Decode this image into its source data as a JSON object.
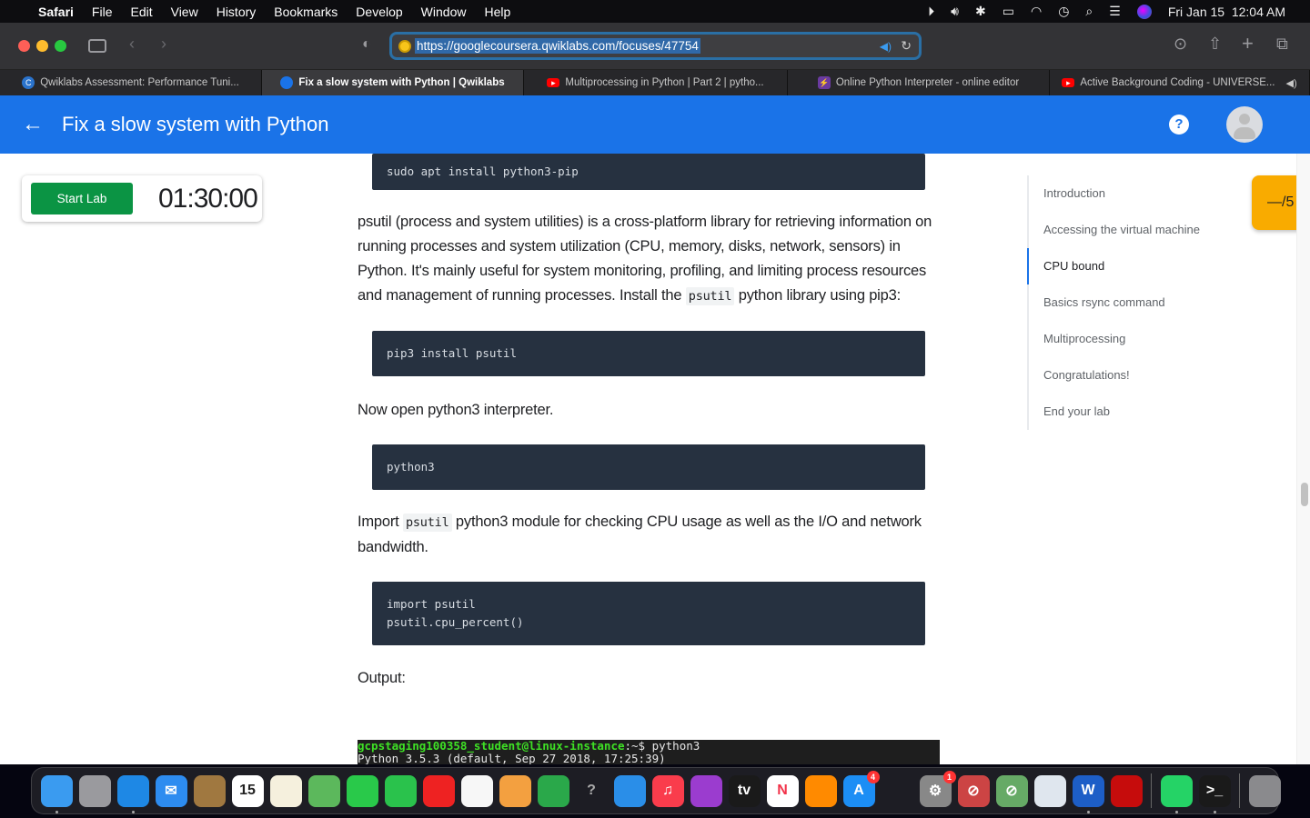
{
  "menubar": {
    "apple_icon": "apple-icon",
    "app_name": "Safari",
    "items": [
      "File",
      "Edit",
      "View",
      "History",
      "Bookmarks",
      "Develop",
      "Window",
      "Help"
    ],
    "status_icons": [
      "play-circle-icon",
      "volume-icon",
      "bluetooth-icon",
      "battery-charging-icon",
      "wifi-icon",
      "time-machine-icon",
      "search-icon",
      "control-center-icon",
      "siri-icon"
    ],
    "datetime": "Fri Jan 15  12:04 AM"
  },
  "toolbar": {
    "url": "https://googlecoursera.qwiklabs.com/focuses/47754"
  },
  "tabs": [
    {
      "title": "Qwiklabs Assessment: Performance Tuni...",
      "icon": "coursera-icon",
      "icon_color": "#2a73cc",
      "active": false
    },
    {
      "title": "Fix a slow system with Python | Qwiklabs",
      "icon": "qwiklabs-icon",
      "icon_color": "#1a73e8",
      "active": true
    },
    {
      "title": "Multiprocessing in Python | Part 2 | pytho...",
      "icon": "youtube-icon",
      "icon_color": "#ff0000",
      "active": false
    },
    {
      "title": "Online Python Interpreter - online editor",
      "icon": "bolt-icon",
      "icon_color": "#6a3aa0",
      "active": false
    },
    {
      "title": "Active Background Coding - UNIVERSE...",
      "icon": "youtube-icon",
      "icon_color": "#ff0000",
      "active": false
    }
  ],
  "appbar": {
    "title": "Fix a slow system with Python",
    "help_label": "?"
  },
  "lab": {
    "start_label": "Start Lab",
    "timer": "01:30:00"
  },
  "content": {
    "code1": "sudo apt install python3-pip",
    "para1": "psutil (process and system utilities) is a cross-platform library for retrieving information on running processes and system utilization (CPU, memory, disks, network, sensors) in Python. It's mainly useful for system monitoring, profiling, and limiting process resources and management of running processes. Install the",
    "para1_code": "psutil",
    "para1_tail": " python library using pip3:",
    "code2": "pip3 install psutil",
    "para2": "Now open python3 interpreter.",
    "code3": "python3",
    "para3_head": "Import ",
    "para3_code": "psutil",
    "para3_tail": " python3 module for checking CPU usage as well as the I/O and network bandwidth.",
    "code4": "import psutil\npsutil.cpu_percent()",
    "para4": "Output:",
    "terminal_prompt_user": "gcpstaging100358_student@linux-instance",
    "terminal_prompt_rest": ":~$ python3",
    "terminal_line2": "Python 3.5.3 (default, Sep 27 2018, 17:25:39)"
  },
  "toc": {
    "items": [
      "Introduction",
      "Accessing the virtual machine",
      "CPU bound",
      "Basics rsync command",
      "Multiprocessing",
      "Congratulations!",
      "End your lab"
    ],
    "active_index": 2
  },
  "score": {
    "label": "—/5"
  },
  "dock": {
    "apps": [
      {
        "name": "finder",
        "label": "",
        "color": "#3a9bf0",
        "running": true
      },
      {
        "name": "launchpad",
        "label": "",
        "color": "#9a9a9e"
      },
      {
        "name": "safari",
        "label": "",
        "color": "#1e88e5",
        "running": true
      },
      {
        "name": "mail",
        "label": "✉",
        "color": "#2d8cf0"
      },
      {
        "name": "contacts",
        "label": "",
        "color": "#a07840"
      },
      {
        "name": "calendar",
        "label": "15",
        "color": "#ffffff",
        "text": "#222"
      },
      {
        "name": "notes",
        "label": "",
        "color": "#f5f0dd"
      },
      {
        "name": "maps",
        "label": "",
        "color": "#5cb85c"
      },
      {
        "name": "messages",
        "label": "",
        "color": "#29c94a"
      },
      {
        "name": "facetime",
        "label": "",
        "color": "#2ac24c"
      },
      {
        "name": "photo-booth",
        "label": "",
        "color": "#e22"
      },
      {
        "name": "photos",
        "label": "",
        "color": "#f7f7f7"
      },
      {
        "name": "pages",
        "label": "",
        "color": "#f3a040"
      },
      {
        "name": "numbers",
        "label": "",
        "color": "#2aa84a"
      },
      {
        "name": "unknown-app",
        "label": "?",
        "color": "transparent",
        "text": "#aaa"
      },
      {
        "name": "keynote",
        "label": "",
        "color": "#2a8ee8"
      },
      {
        "name": "music",
        "label": "♫",
        "color": "#fa3c4c"
      },
      {
        "name": "podcasts",
        "label": "",
        "color": "#9b3ccf"
      },
      {
        "name": "apple-tv",
        "label": "tv",
        "color": "#1a1a1a"
      },
      {
        "name": "news",
        "label": "N",
        "color": "#ffffff",
        "text": "#f2334a"
      },
      {
        "name": "books",
        "label": "",
        "color": "#ff8a00"
      },
      {
        "name": "app-store",
        "label": "A",
        "color": "#1c8ef5",
        "badge": "4"
      },
      {
        "name": "python-launcher",
        "label": "",
        "color": "transparent"
      },
      {
        "name": "system-preferences",
        "label": "⚙",
        "color": "#888",
        "badge": "1"
      },
      {
        "name": "blocked-app-1",
        "label": "⊘",
        "color": "#c44"
      },
      {
        "name": "blocked-app-2",
        "label": "⊘",
        "color": "#6a6"
      },
      {
        "name": "preview",
        "label": "",
        "color": "#dfe6ee"
      },
      {
        "name": "word",
        "label": "W",
        "color": "#1d5ec7",
        "running": true
      },
      {
        "name": "acrobat",
        "label": "",
        "color": "#c60c0c"
      },
      {
        "sep": true
      },
      {
        "name": "whatsapp",
        "label": "",
        "color": "#25d366",
        "running": true
      },
      {
        "name": "terminal",
        "label": ">_",
        "color": "#1a1a1a",
        "running": true
      },
      {
        "sep": true
      },
      {
        "name": "trash",
        "label": "",
        "color": "#8a8a8d"
      }
    ]
  }
}
